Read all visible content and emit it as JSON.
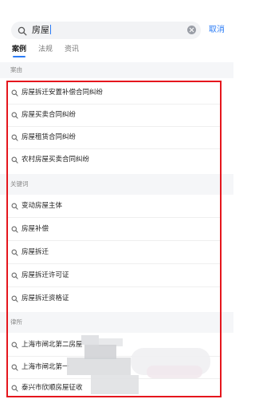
{
  "search": {
    "query": "房屋",
    "cancel_label": "取消"
  },
  "tabs": [
    {
      "label": "案例",
      "active": true
    },
    {
      "label": "法规",
      "active": false
    },
    {
      "label": "资讯",
      "active": false
    }
  ],
  "sections": [
    {
      "title": "案由",
      "items": [
        "房屋拆迁安置补偿合同纠纷",
        "房屋买卖合同纠纷",
        "房屋租赁合同纠纷",
        "农村房屋买卖合同纠纷"
      ]
    },
    {
      "title": "关键词",
      "items": [
        "变动房屋主体",
        "房屋补偿",
        "房屋拆迁",
        "房屋拆迁许可证",
        "房屋拆迁资格证"
      ]
    },
    {
      "title": "律所",
      "items": [
        "上海市闸北第二房屋",
        "上海市闸北第一",
        "泰兴市欣顺房屋征收"
      ]
    }
  ],
  "colors": {
    "accent": "#2b7cf6",
    "highlight_frame": "#e5161d"
  }
}
